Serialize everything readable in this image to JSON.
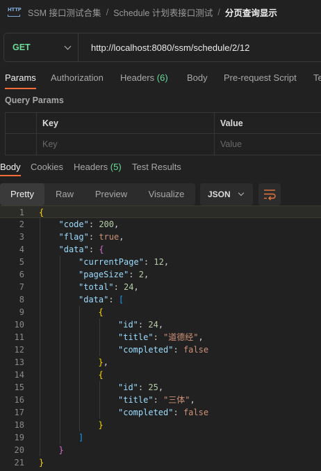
{
  "breadcrumb": {
    "icon_text": "HTTP",
    "items": [
      "SSM 接口测试合集",
      "Schedule 计划表接口测试",
      "分页查询显示"
    ],
    "separator": "/"
  },
  "request": {
    "method": "GET",
    "url": "http://localhost:8080/ssm/schedule/2/12"
  },
  "request_tabs": [
    {
      "label": "Params",
      "count": ""
    },
    {
      "label": "Authorization",
      "count": ""
    },
    {
      "label": "Headers",
      "count": "(6)"
    },
    {
      "label": "Body",
      "count": ""
    },
    {
      "label": "Pre-request Script",
      "count": ""
    },
    {
      "label": "Te",
      "count": ""
    }
  ],
  "query_params": {
    "title": "Query Params",
    "columns": [
      "Key",
      "Value"
    ],
    "placeholders": [
      "Key",
      "Value"
    ]
  },
  "response_tabs": [
    {
      "label": "Body",
      "count": ""
    },
    {
      "label": "Cookies",
      "count": ""
    },
    {
      "label": "Headers",
      "count": "(5)"
    },
    {
      "label": "Test Results",
      "count": ""
    }
  ],
  "view_modes": [
    "Pretty",
    "Raw",
    "Preview",
    "Visualize"
  ],
  "format": "JSON",
  "colors": {
    "accent": "#ff6c37",
    "method": "#6bdd9a",
    "count": "#6bdd9a"
  },
  "icons": {
    "http": "http-icon",
    "wrap": "wrap-lines-icon",
    "chevron": "chevron-down-icon"
  },
  "code_lines": [
    {
      "n": "1",
      "text": "{"
    },
    {
      "n": "2",
      "text": "\"code\": 200,"
    },
    {
      "n": "3",
      "text": "\"flag\": true,"
    },
    {
      "n": "4",
      "text": "\"data\": {"
    },
    {
      "n": "5",
      "text": "\"currentPage\": 12,"
    },
    {
      "n": "6",
      "text": "\"pageSize\": 2,"
    },
    {
      "n": "7",
      "text": "\"total\": 24,"
    },
    {
      "n": "8",
      "text": "\"data\": ["
    },
    {
      "n": "9",
      "text": "{"
    },
    {
      "n": "10",
      "text": "\"id\": 24,"
    },
    {
      "n": "11",
      "text": "\"title\": \"道德经\","
    },
    {
      "n": "12",
      "text": "\"completed\": false"
    },
    {
      "n": "13",
      "text": "},"
    },
    {
      "n": "14",
      "text": "{"
    },
    {
      "n": "15",
      "text": "\"id\": 25,"
    },
    {
      "n": "16",
      "text": "\"title\": \"三体\","
    },
    {
      "n": "17",
      "text": "\"completed\": false"
    },
    {
      "n": "18",
      "text": "}"
    },
    {
      "n": "19",
      "text": "]"
    },
    {
      "n": "20",
      "text": "}"
    },
    {
      "n": "21",
      "text": "}"
    }
  ]
}
